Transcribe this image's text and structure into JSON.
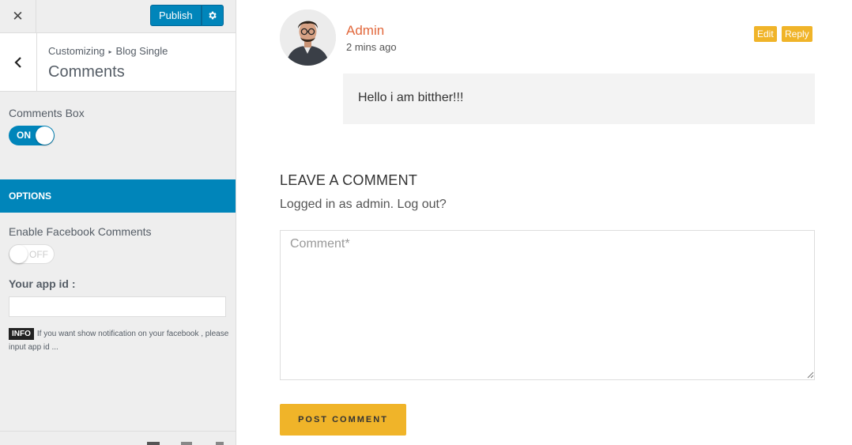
{
  "customizer": {
    "close_icon": "close-icon",
    "publish_label": "Publish",
    "settings_icon": "gear-icon",
    "back_icon": "chevron-left-icon",
    "breadcrumb_root": "Customizing",
    "breadcrumb_separator_icon": "caret-right-icon",
    "breadcrumb_parent": "Blog Single",
    "section_title": "Comments",
    "comments_box": {
      "label": "Comments Box",
      "toggle_text": "ON",
      "state": true
    },
    "options_heading": "OPTIONS",
    "facebook_comments": {
      "label": "Enable Facebook Comments",
      "toggle_text": "OFF",
      "state": false
    },
    "app_id": {
      "label": "Your app id :",
      "value": ""
    },
    "info": {
      "badge": "INFO",
      "text": "If you want show notification on your facebook , please input app id ..."
    },
    "accent_color": "#0085ba"
  },
  "preview": {
    "comment": {
      "author": "Admin",
      "time": "2 mins ago",
      "edit_label": "Edit",
      "reply_label": "Reply",
      "body": "Hello i am bitther!!!"
    },
    "leave_comment": {
      "title": "LEAVE A COMMENT",
      "logged_in_text": "Logged in as admin. Log out?",
      "placeholder": "Comment*",
      "submit_label": "POST COMMENT"
    },
    "author_color": "#e2683c",
    "button_color": "#f0b429"
  }
}
